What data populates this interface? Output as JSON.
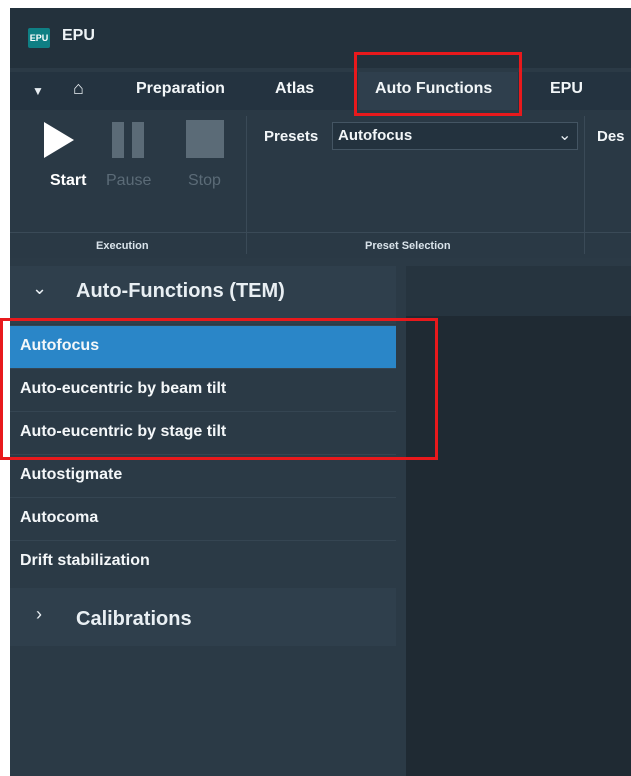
{
  "app": {
    "logo_text": "EPU",
    "title": "EPU"
  },
  "tabs": {
    "items": [
      {
        "label": "Preparation"
      },
      {
        "label": "Atlas"
      },
      {
        "label": "Auto Functions"
      },
      {
        "label": "EPU"
      }
    ]
  },
  "ribbon": {
    "execution": {
      "start_label": "Start",
      "pause_label": "Pause",
      "stop_label": "Stop",
      "group_label": "Execution"
    },
    "preset": {
      "label": "Presets",
      "value": "Autofocus",
      "group_label": "Preset Selection"
    },
    "desc_label": "Des"
  },
  "leftpanel": {
    "auto_functions_title": "Auto-Functions (TEM)",
    "items": [
      {
        "label": "Autofocus"
      },
      {
        "label": "Auto-eucentric by beam tilt"
      },
      {
        "label": "Auto-eucentric by stage tilt"
      },
      {
        "label": "Autostigmate"
      },
      {
        "label": "Autocoma"
      },
      {
        "label": "Drift stabilization"
      }
    ],
    "calibrations_title": "Calibrations"
  },
  "colors": {
    "accent_selected": "#2a86c8",
    "highlight_red": "#e8191c",
    "background": "#2b3a46"
  }
}
